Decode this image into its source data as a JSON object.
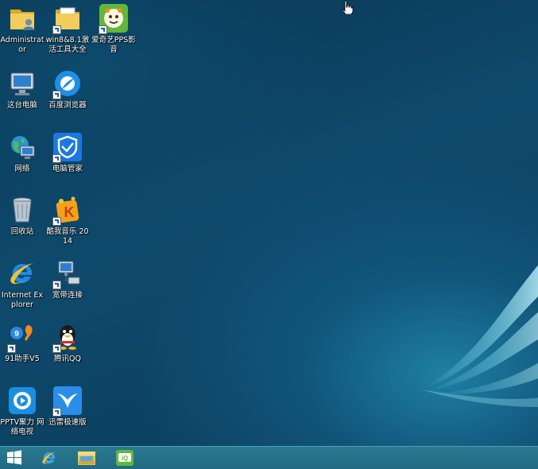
{
  "desktop": {
    "icons": [
      {
        "id": "administrator",
        "label": "Administrator"
      },
      {
        "id": "activation-tools",
        "label": "win8&8.1激活工具大全"
      },
      {
        "id": "iqiyi-pps",
        "label": "爱奇艺PPS影音"
      },
      {
        "id": "this-pc",
        "label": "这台电脑"
      },
      {
        "id": "baidu-browser",
        "label": "百度浏览器"
      },
      {
        "id": "network",
        "label": "网络"
      },
      {
        "id": "pc-manager",
        "label": "电脑管家"
      },
      {
        "id": "recycle-bin",
        "label": "回收站"
      },
      {
        "id": "kuwo-music",
        "label": "酷我音乐 2014"
      },
      {
        "id": "internet-explorer",
        "label": "Internet Explorer"
      },
      {
        "id": "broadband",
        "label": "宽带连接"
      },
      {
        "id": "91-assistant",
        "label": "91助手V5"
      },
      {
        "id": "tencent-qq",
        "label": "腾讯QQ"
      },
      {
        "id": "pptv",
        "label": "PPTV聚力 网络电视"
      },
      {
        "id": "xunlei",
        "label": "迅雷极速版"
      }
    ]
  },
  "taskbar": {
    "items": [
      "start",
      "internet-explorer",
      "file-explorer",
      "iqiyi"
    ]
  },
  "colors": {
    "desktop": "#0c3d5c",
    "taskbar": "#237189",
    "label": "#ffffff"
  }
}
